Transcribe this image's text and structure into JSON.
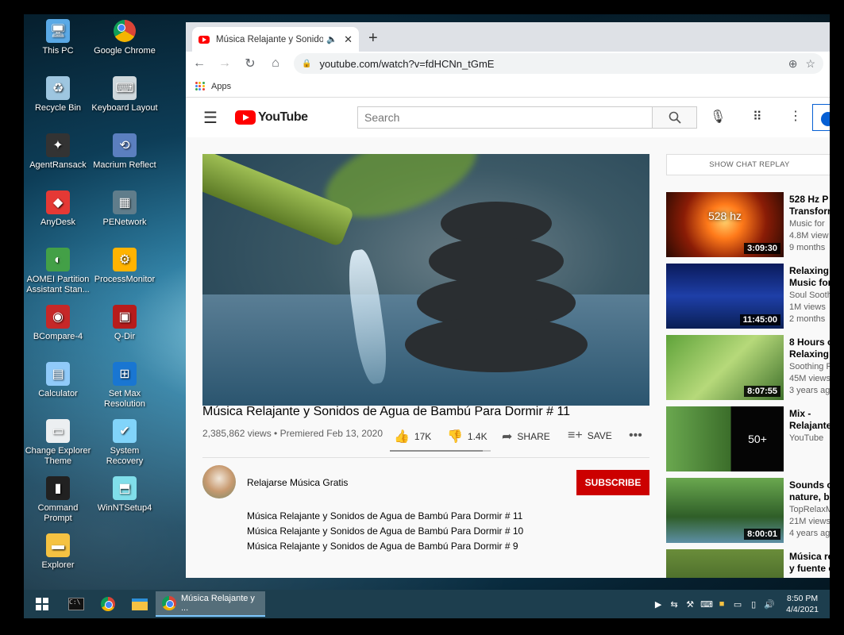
{
  "desktop": {
    "icons": [
      {
        "label": "This PC",
        "icon": "computer-icon"
      },
      {
        "label": "Google Chrome",
        "icon": "chrome-icon"
      },
      {
        "label": "Recycle Bin",
        "icon": "recycle-bin-icon"
      },
      {
        "label": "Keyboard Layout",
        "icon": "keyboard-icon"
      },
      {
        "label": "AgentRansack",
        "icon": "agentransack-icon"
      },
      {
        "label": "Macrium Reflect",
        "icon": "macrium-icon"
      },
      {
        "label": "AnyDesk",
        "icon": "anydesk-icon"
      },
      {
        "label": "PENetwork",
        "icon": "network-icon"
      },
      {
        "label": "AOMEI Partition Assistant Stan...",
        "icon": "aomei-icon"
      },
      {
        "label": "ProcessMonitor",
        "icon": "process-monitor-icon"
      },
      {
        "label": "BCompare-4",
        "icon": "bcompare-icon"
      },
      {
        "label": "Q-Dir",
        "icon": "qdir-icon"
      },
      {
        "label": "Calculator",
        "icon": "calculator-icon"
      },
      {
        "label": "Set Max Resolution",
        "icon": "resolution-icon"
      },
      {
        "label": "Change Explorer Theme",
        "icon": "theme-icon"
      },
      {
        "label": "System Recovery",
        "icon": "recovery-icon"
      },
      {
        "label": "Command Prompt",
        "icon": "cmd-icon"
      },
      {
        "label": "WinNTSetup4",
        "icon": "setup-icon"
      },
      {
        "label": "Explorer",
        "icon": "folder-icon"
      }
    ]
  },
  "browser": {
    "tab_title": "Música Relajante y Sonidos d",
    "new_tab": "+",
    "url": "youtube.com/watch?v=fdHCNn_tGmE",
    "bookmarks": {
      "apps": "Apps"
    }
  },
  "youtube": {
    "logo": "YouTube",
    "search_placeholder": "Search",
    "video": {
      "title": "Música Relajante y Sonidos de Agua de Bambú Para Dormir # 11",
      "meta": "2,385,862 views • Premiered Feb 13, 2020",
      "likes": "17K",
      "dislikes": "1.4K",
      "share": "SHARE",
      "save": "SAVE",
      "like_ratio": 0.92
    },
    "channel": {
      "name": "Relajarse Música Gratis",
      "subscribe": "SUBSCRIBE"
    },
    "description": [
      "Música Relajante y Sonidos de Agua de Bambú Para Dormir # 11",
      "Música Relajante y Sonidos de Agua de Bambú Para Dormir # 10",
      "Música Relajante y Sonidos de Agua de Bambú Para Dormir # 9"
    ],
    "chat_replay": "SHOW CHAT REPLAY",
    "recommendations": [
      {
        "title1": "528 Hz P",
        "title2": "Transforr",
        "line1": "Music for",
        "line2": "4.8M view",
        "line3": "9 months",
        "duration": "3:09:30",
        "overlay": "528 hz"
      },
      {
        "title1": "Relaxing",
        "title2": "Music for",
        "line1": "Soul Sooth",
        "line2": "1M views",
        "line3": "2 months",
        "duration": "11:45:00"
      },
      {
        "title1": "8 Hours o",
        "title2": "Relaxing",
        "line1": "Soothing R",
        "line2": "45M views",
        "line3": "3 years ag",
        "duration": "8:07:55"
      },
      {
        "title1": "Mix -",
        "title2": "Relajante",
        "line1": "YouTube",
        "line2": "",
        "line3": "",
        "duration": "",
        "overlay": "50+"
      },
      {
        "title1": "Sounds o",
        "title2": "nature, bi",
        "line1": "TopRelaxM",
        "line2": "21M views",
        "line3": "4 years ag",
        "duration": "8:00:01"
      },
      {
        "title1": "Música re",
        "title2": "y fuente c",
        "line1": "",
        "line2": "",
        "line3": "",
        "duration": ""
      }
    ]
  },
  "taskbar": {
    "active_task": "Música Relajante y ...",
    "time": "8:50 PM",
    "date": "4/4/2021"
  }
}
